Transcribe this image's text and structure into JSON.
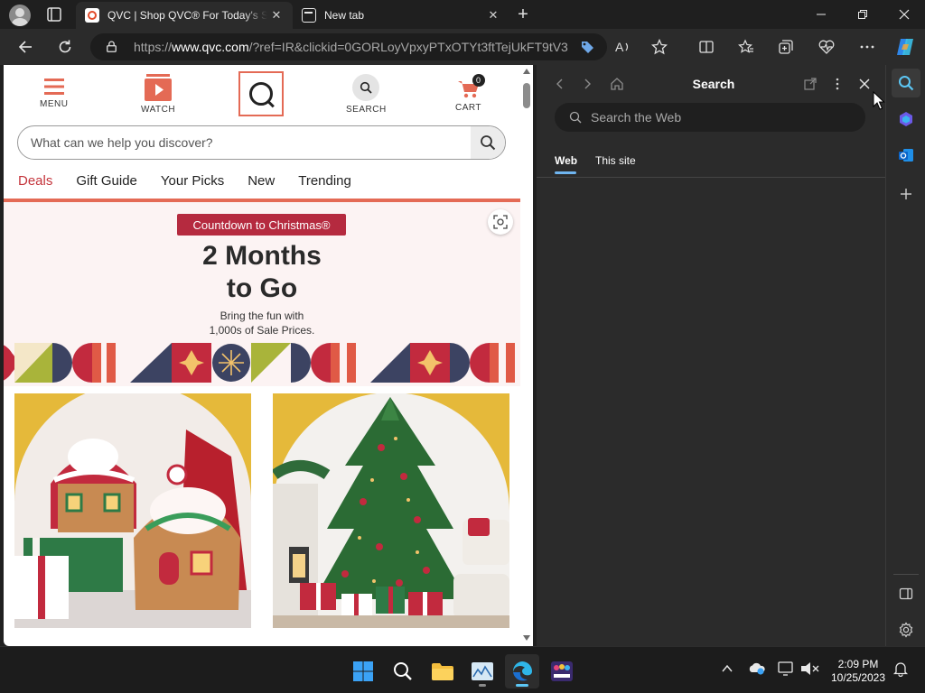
{
  "browser": {
    "tabs": [
      {
        "title": "QVC | Shop QVC® For Today's Special Value",
        "active": true
      },
      {
        "title": "New tab",
        "active": false
      }
    ],
    "url": {
      "prefix": "https://",
      "host": "www.qvc.com",
      "rest": "/?ref=IR&clickid=0GORLoyVpxyPTxOTYt3ftTejUkFT9tV3..."
    },
    "accent_color": "#5cc7f5"
  },
  "site": {
    "header": {
      "menu_label": "MENU",
      "watch_label": "WATCH",
      "search_label": "SEARCH",
      "cart_label": "CART",
      "cart_count": "0"
    },
    "search_placeholder": "What can we help you discover?",
    "nav": [
      "Deals",
      "Gift Guide",
      "Your Picks",
      "New",
      "Trending"
    ],
    "banner": {
      "pill": "Countdown to Christmas®",
      "headline_line1": "2 Months",
      "headline_line2": "to Go",
      "sub_line1": "Bring the fun with",
      "sub_line2": "1,000s of Sale Prices."
    },
    "brand_color": "#e46a55",
    "deal_color": "#c4343b"
  },
  "sidepanel": {
    "title": "Search",
    "search_placeholder": "Search the Web",
    "tabs": [
      "Web",
      "This site"
    ]
  },
  "taskbar": {
    "time": "2:09 PM",
    "date": "10/25/2023"
  }
}
